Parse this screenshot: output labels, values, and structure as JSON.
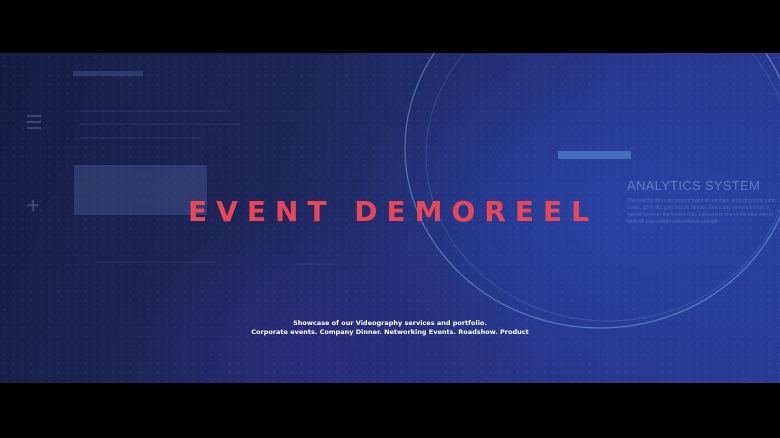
{
  "video": {
    "title": "EVENT DEMOREEL",
    "analytics_heading": "ANALYTICS SYSTEM",
    "analytics_text": "The healthy life is an ancient trend of our days. A lot of people jump a skin, go to the gym and do fitness. Every day someone buys a special ticket to the fitness club. Fitbased is one of the best way to keep fit, lose weight and develop strength.",
    "caption_line1": "Showcase of our Videography services and portfolio.",
    "caption_line2": "Corporate events. Company Dinner. Networking Events. Roadshow. Product"
  },
  "icons": {
    "menu": "menu-icon",
    "plus": "plus-icon"
  },
  "colors": {
    "title": "#e8475a",
    "accent_bar": "#4f7fc8",
    "ring": "#7fb0e0",
    "background_dark": "#161d44",
    "background_light": "#2a3c94"
  }
}
